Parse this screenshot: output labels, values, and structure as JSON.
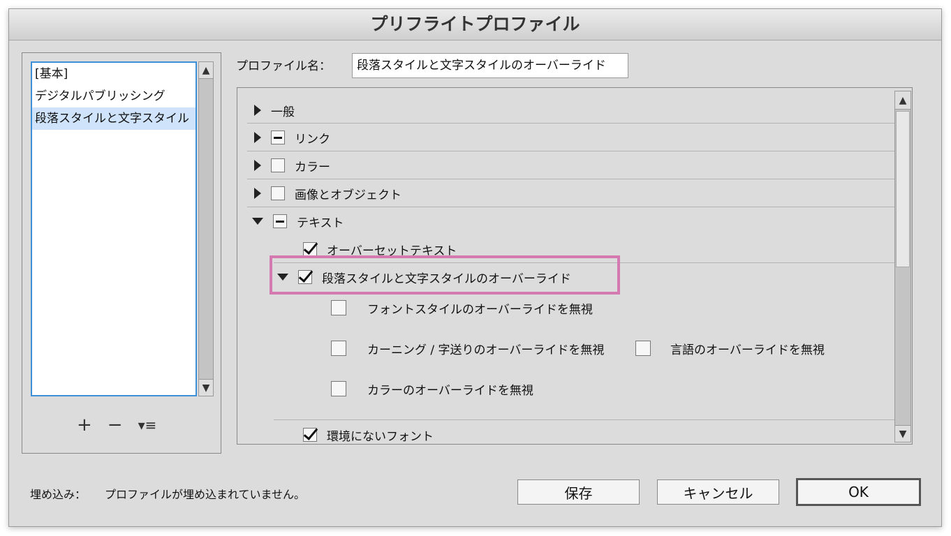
{
  "window": {
    "title": "プリフライトプロファイル"
  },
  "profiles": {
    "items": [
      "[基本]",
      "デジタルパブリッシング",
      "段落スタイルと文字スタイル"
    ],
    "selected_index": 2,
    "tools": {
      "add": "+",
      "remove": "−",
      "menu": "▾≡"
    }
  },
  "profile_name": {
    "label": "プロファイル名：",
    "value": "段落スタイルと文字スタイルのオーバーライド"
  },
  "tree": {
    "general": "一般",
    "links": "リンク",
    "color": "カラー",
    "images": "画像とオブジェクト",
    "text": "テキスト",
    "overset": "オーバーセットテキスト",
    "override": "段落スタイルと文字スタイルのオーバーライド",
    "ignore_font_style": "フォントスタイルのオーバーライドを無視",
    "ignore_kerning": "カーニング / 字送りのオーバーライドを無視",
    "ignore_language": "言語のオーバーライドを無視",
    "ignore_color": "カラーのオーバーライドを無視",
    "missing_fonts": "環境にないフォント"
  },
  "footer": {
    "embed_label": "埋め込み：",
    "embed_status": "プロファイルが埋め込まれていません。",
    "save": "保存",
    "cancel": "キャンセル",
    "ok": "OK"
  },
  "colors": {
    "highlight": "#d47ab0",
    "selection": "#cfe3fb",
    "list_border": "#3d8fd8"
  }
}
